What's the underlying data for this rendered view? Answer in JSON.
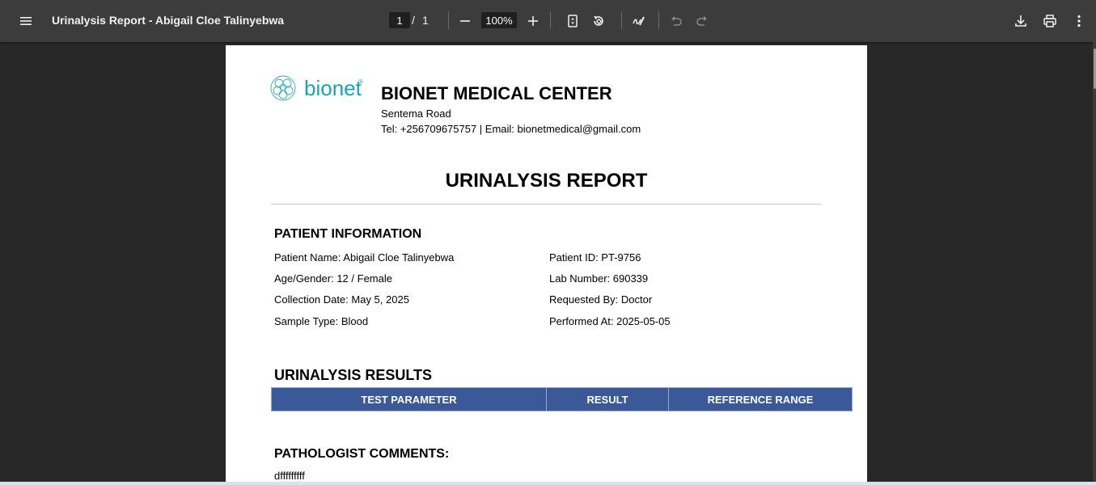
{
  "toolbar": {
    "menu_icon": "hamburger-menu-icon",
    "title": "Urinalysis Report - Abigail Cloe Talinyebwa",
    "current_page": "1",
    "page_separator": "/",
    "total_pages": "1",
    "zoom": "100%",
    "icons": [
      "zoom-out-icon",
      "zoom-in-icon",
      "fit-page-icon",
      "rotate-icon",
      "draw-icon",
      "undo-icon",
      "redo-icon",
      "download-icon",
      "print-icon",
      "more-options-icon"
    ]
  },
  "document": {
    "logo_text": "bionet",
    "logo_reg": "®",
    "center_name": "BIONET MEDICAL CENTER",
    "address": "Sentema Road",
    "contact": "Tel: +256709675757 | Email: bionetmedical@gmail.com",
    "report_title": "URINALYSIS REPORT",
    "patient_section": {
      "title": "PATIENT INFORMATION",
      "left": [
        "Patient Name: Abigail Cloe Talinyebwa",
        "Age/Gender: 12 / Female",
        "Collection Date: May 5, 2025",
        "Sample Type: Blood"
      ],
      "right": [
        "Patient ID: PT-9756",
        "Lab Number: 690339",
        "Requested By: Doctor",
        "Performed At: 2025-05-05"
      ]
    },
    "results_section": {
      "title": "URINALYSIS RESULTS",
      "columns": [
        "TEST PARAMETER",
        "RESULT",
        "REFERENCE RANGE"
      ],
      "header_color": "#3b5998"
    },
    "comments_section": {
      "title": "PATHOLOGIST COMMENTS:",
      "text": "dfffffffff"
    }
  }
}
